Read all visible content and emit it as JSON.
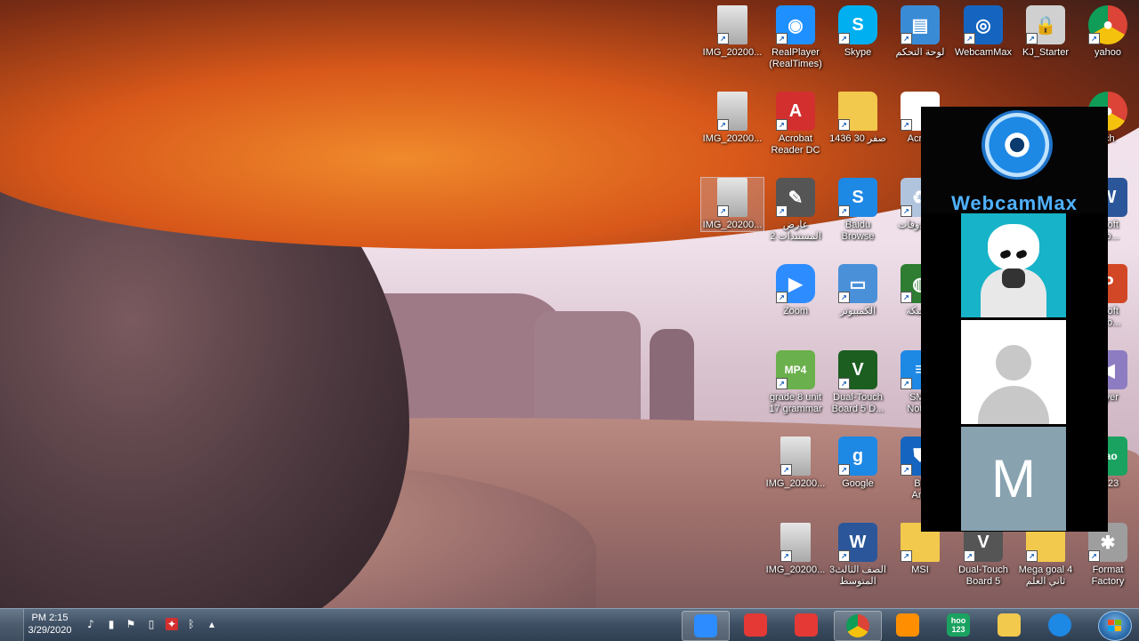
{
  "desktop": {
    "icons": [
      {
        "id": "img1",
        "label": "IMG_20200...",
        "icon": "image-file-icon",
        "color": "#c9c9c9"
      },
      {
        "id": "realplayer",
        "label": "RealPlayer\n(RealTimes)",
        "icon": "realplayer-icon",
        "color": "#1e90ff"
      },
      {
        "id": "skype",
        "label": "Skype",
        "icon": "skype-icon",
        "color": "#00aff0"
      },
      {
        "id": "control-panel",
        "label": "لوحة التحكم",
        "icon": "control-panel-icon",
        "color": "#3a8bd6"
      },
      {
        "id": "webcammax",
        "label": "WebcamMax",
        "icon": "webcammax-icon",
        "color": "#1565c0"
      },
      {
        "id": "kj-starter",
        "label": "KJ_Starter",
        "icon": "lock-shield-icon",
        "color": "#d0d0d0"
      },
      {
        "id": "yahoo",
        "label": "yahoo",
        "icon": "chrome-icon",
        "color": "#e53935"
      },
      {
        "id": "img2",
        "label": "IMG_20200...",
        "icon": "image-file-icon",
        "color": "#c9c9c9"
      },
      {
        "id": "acrobat-dc",
        "label": "Acrobat\nReader DC",
        "icon": "acrobat-icon",
        "color": "#d32f2f"
      },
      {
        "id": "folder-1436",
        "label": "صفر 30 1436",
        "icon": "folder-icon",
        "color": "#f2c94c"
      },
      {
        "id": "acrobat2",
        "label": "Acrob",
        "icon": "acrobat-doc-icon",
        "color": "#ffffff"
      },
      {
        "id": "search-partial",
        "label": "rch",
        "icon": "chrome-icon",
        "color": "#e53935"
      },
      {
        "id": "img3",
        "label": "IMG_20200...",
        "icon": "image-file-icon",
        "color": "#c9c9c9"
      },
      {
        "id": "sign-docs",
        "label": "عارض\nالمستندات 2",
        "icon": "signature-icon",
        "color": "#555555"
      },
      {
        "id": "baidu",
        "label": "Baidu\nBrowse",
        "icon": "baidu-icon",
        "color": "#1e88e5"
      },
      {
        "id": "trash",
        "label": "المحذوفات",
        "icon": "recycle-bin-icon",
        "color": "#b0c4de"
      },
      {
        "id": "word-partial",
        "label": "osoft\nWo...",
        "icon": "word-icon",
        "color": "#2b579a"
      },
      {
        "id": "zoom",
        "label": "Zoom",
        "icon": "zoom-icon",
        "color": "#2d8cff"
      },
      {
        "id": "computer",
        "label": "الكمبيوتر",
        "icon": "computer-icon",
        "color": "#4a90d9"
      },
      {
        "id": "network",
        "label": "الشبكة",
        "icon": "globe-icon",
        "color": "#2e7d32"
      },
      {
        "id": "ppt-partial",
        "label": "osoft\nt Po...",
        "icon": "powerpoint-icon",
        "color": "#d24726"
      },
      {
        "id": "mp4-file",
        "label": "grade 8 unit\n17 grammar",
        "icon": "mp4-file-icon",
        "color": "#6ab04c"
      },
      {
        "id": "dual-touch-d",
        "label": "Dual-Touch\nBoard 5 D...",
        "icon": "dual-touch-icon",
        "color": "#1b5e20"
      },
      {
        "id": "smart-notebook",
        "label": "SMA\nNoteb",
        "icon": "smart-notebook-icon",
        "color": "#1e88e5"
      },
      {
        "id": "player-partial",
        "label": "layer",
        "icon": "player-icon",
        "color": "#8e7cc3"
      },
      {
        "id": "img4",
        "label": "IMG_20200...",
        "icon": "image-file-icon",
        "color": "#c9c9c9"
      },
      {
        "id": "google",
        "label": "Google",
        "icon": "google-icon",
        "color": "#1e88e5"
      },
      {
        "id": "antivirus",
        "label": "Ba\nAnti",
        "icon": "shield-icon",
        "color": "#1565c0"
      },
      {
        "id": "hao123-desk",
        "label": "o123",
        "icon": "hao123-icon",
        "color": "#1aa260"
      },
      {
        "id": "img5",
        "label": "IMG_20200...",
        "icon": "image-file-icon",
        "color": "#c9c9c9"
      },
      {
        "id": "grade3-doc",
        "label": "3الصف الثالث\nالمتوسط",
        "icon": "word-doc-icon",
        "color": "#2b579a"
      },
      {
        "id": "msi",
        "label": "MSI",
        "icon": "folder-icon",
        "color": "#f2c94c"
      },
      {
        "id": "dual-touch",
        "label": "Dual-Touch\nBoard 5",
        "icon": "dual-touch-icon",
        "color": "#555555"
      },
      {
        "id": "mega-goal",
        "label": "Mega goal 4\nثاني العلم",
        "icon": "folder-icon",
        "color": "#f2c94c"
      },
      {
        "id": "format-factory",
        "label": "Format\nFactory",
        "icon": "format-factory-icon",
        "color": "#9e9e9e"
      }
    ],
    "selected_icon": "img3"
  },
  "webcam_overlay": {
    "brand": "WebcamMax",
    "participant_initial": "M",
    "colors": {
      "brand": "#4fb2ff",
      "tile_teal": "#17b3c8",
      "tile_slate": "#88a2b0"
    }
  },
  "taskbar": {
    "clock_time": "PM 2:15",
    "clock_date": "3/29/2020",
    "pinned": [
      {
        "id": "zoom",
        "icon": "zoom-icon",
        "color": "#2d8cff"
      },
      {
        "id": "baidu",
        "icon": "baidu-icon",
        "color": "#e53935"
      },
      {
        "id": "record",
        "icon": "record-icon",
        "color": "#e53935"
      },
      {
        "id": "chrome",
        "icon": "chrome-icon",
        "color": "#fbc02d"
      },
      {
        "id": "media",
        "icon": "media-player-icon",
        "color": "#ff8f00"
      },
      {
        "id": "hao123",
        "icon": "hao123-icon",
        "color": "#1aa260",
        "text": "hoo\n123"
      },
      {
        "id": "explorer",
        "icon": "folder-icon",
        "color": "#f2c94c"
      },
      {
        "id": "ie",
        "icon": "internet-explorer-icon",
        "color": "#1e88e5"
      }
    ],
    "tray": [
      "volume-icon",
      "network-signal-icon",
      "flag-icon",
      "battery-icon",
      "acrobat-tray-icon",
      "bluetooth-icon",
      "show-hidden-icon"
    ]
  }
}
